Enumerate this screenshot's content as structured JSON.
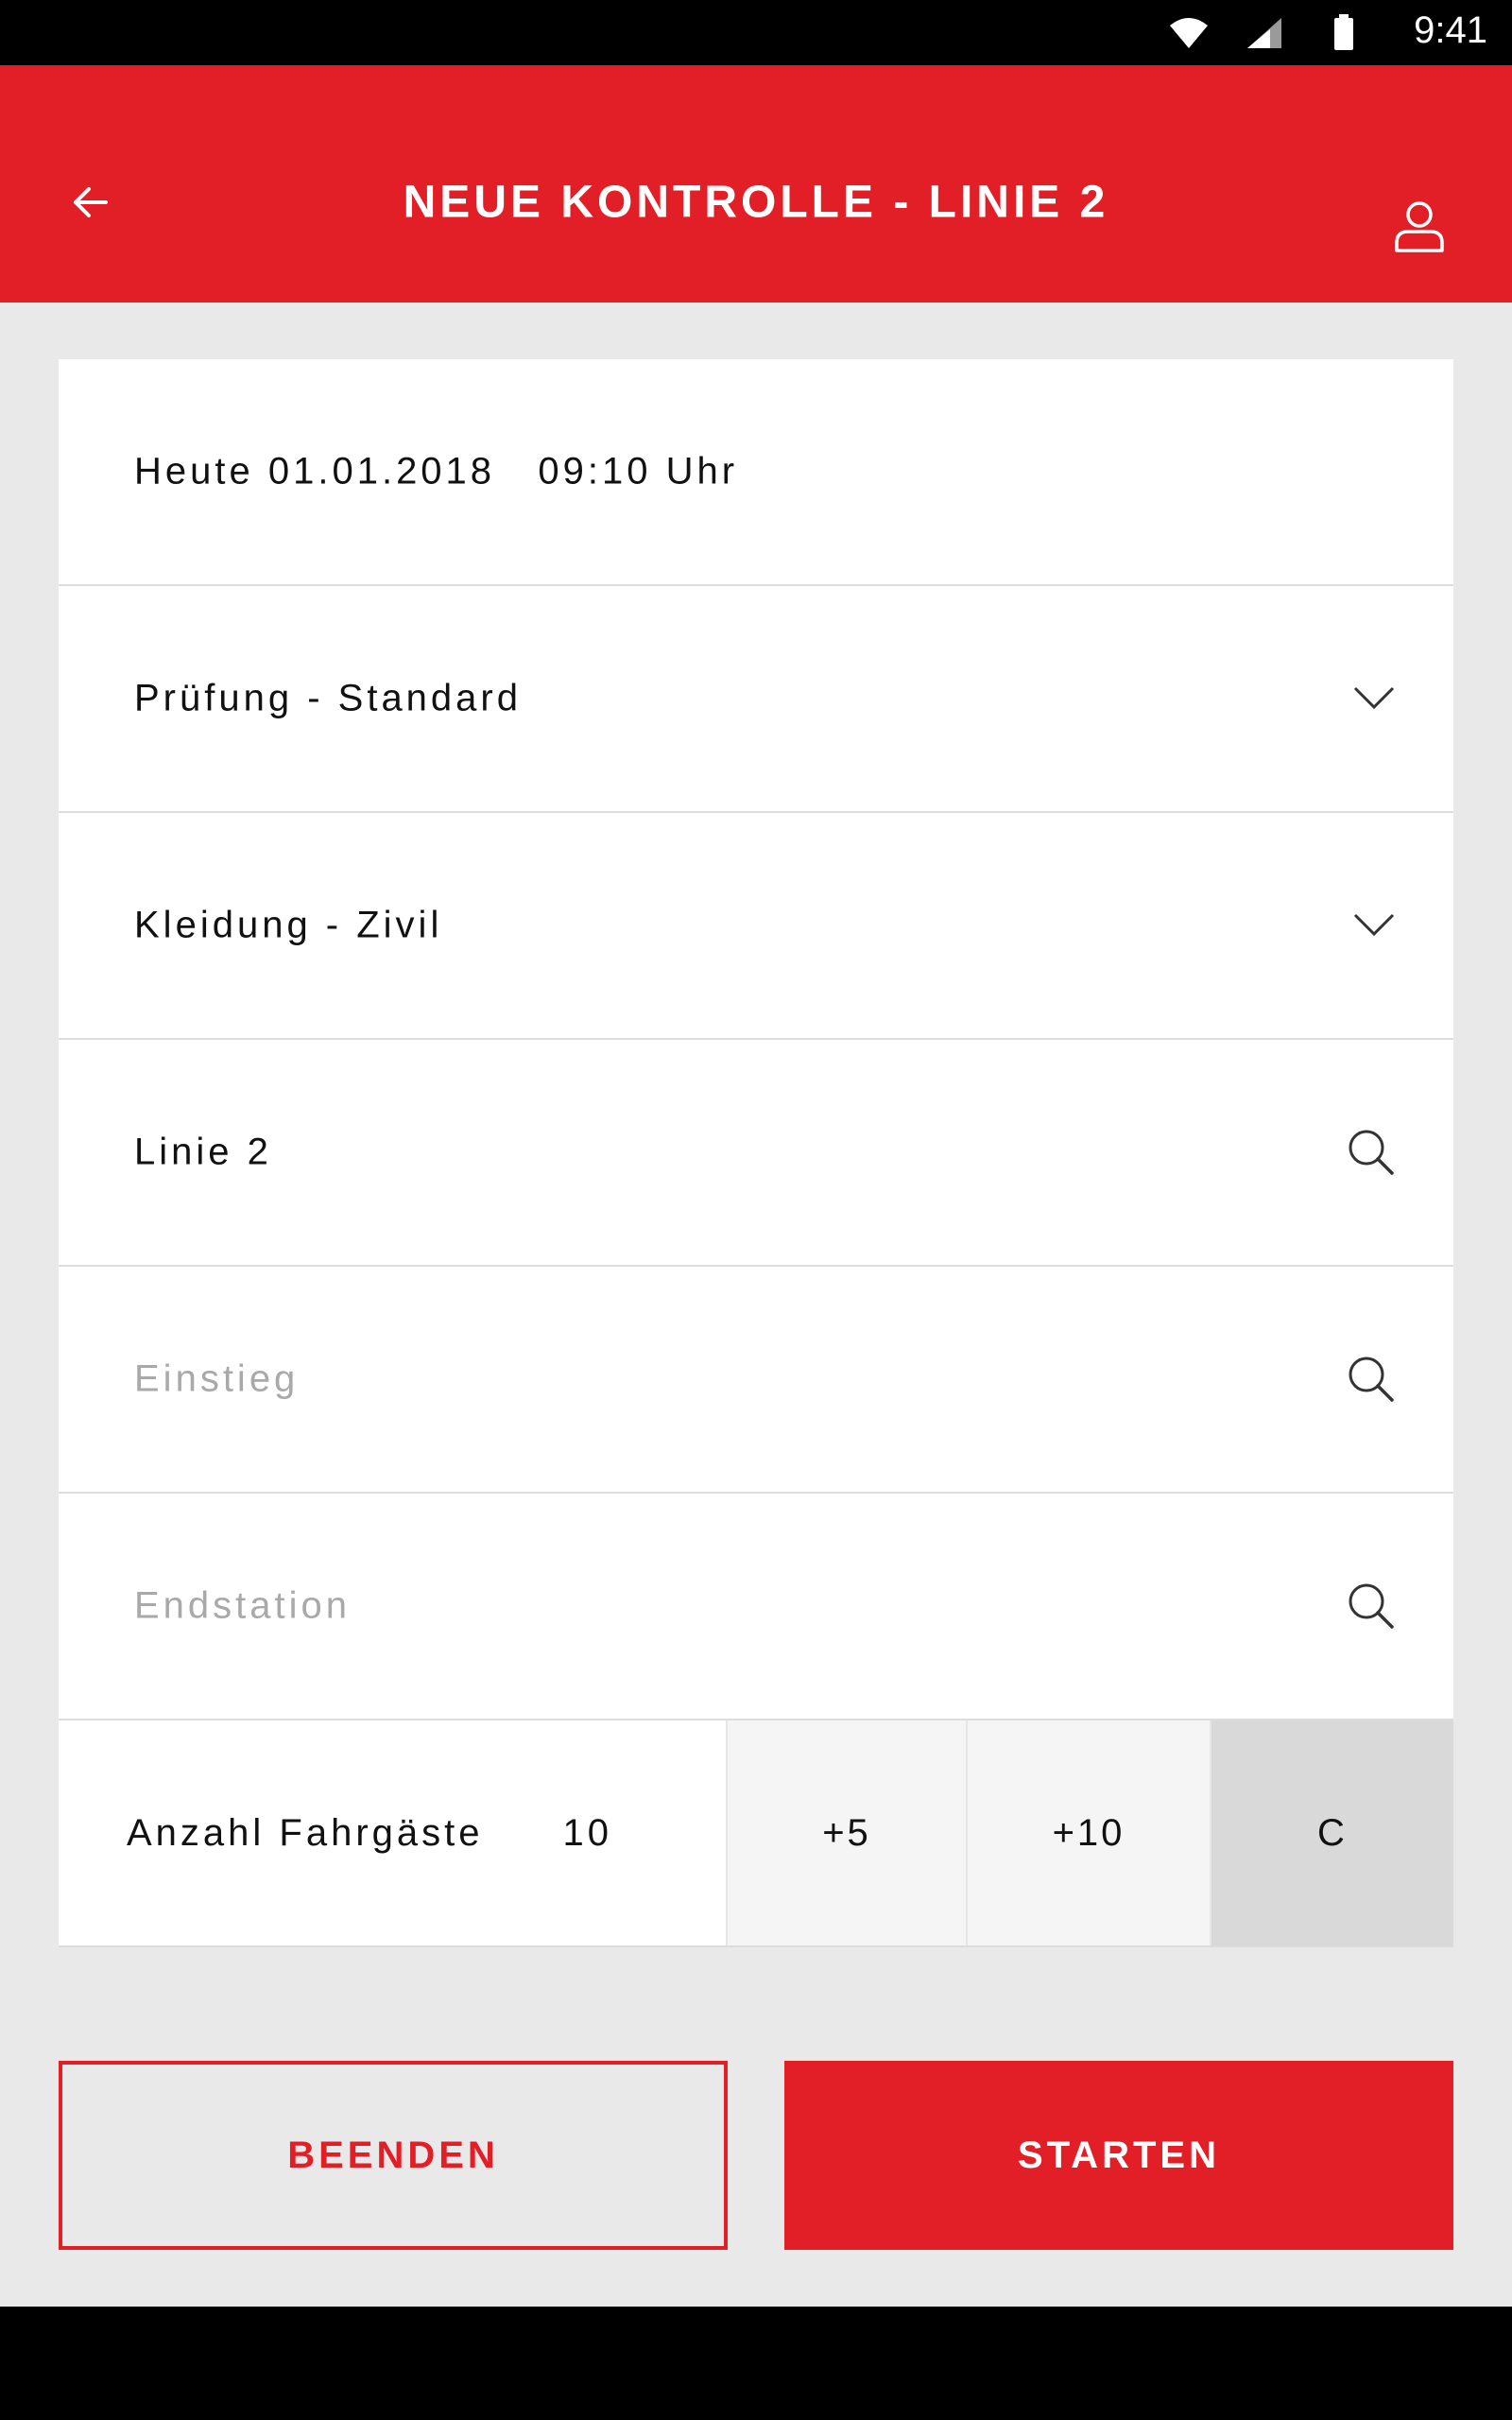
{
  "status_bar": {
    "time": "9:41",
    "icons": [
      "wifi-icon",
      "signal-icon",
      "battery-icon"
    ]
  },
  "app_bar": {
    "title": "NEUE KONTROLLE - LINIE 2",
    "back_icon": "arrow-left-icon",
    "profile_icon": "user-icon"
  },
  "form": {
    "datetime": "Heute 01.01.2018   09:10 Uhr",
    "pruefung": "Prüfung - Standard",
    "kleidung": "Kleidung - Zivil",
    "linie": "Linie 2",
    "einstieg_placeholder": "Einstieg",
    "endstation_placeholder": "Endstation"
  },
  "counter": {
    "label": "Anzahl Fahrgäste",
    "value": "10",
    "plus5": "+5",
    "plus10": "+10",
    "clear": "C"
  },
  "actions": {
    "end_label": "BEENDEN",
    "start_label": "STARTEN"
  },
  "colors": {
    "brand_red": "#e21f26",
    "background": "#e9e9e9"
  }
}
